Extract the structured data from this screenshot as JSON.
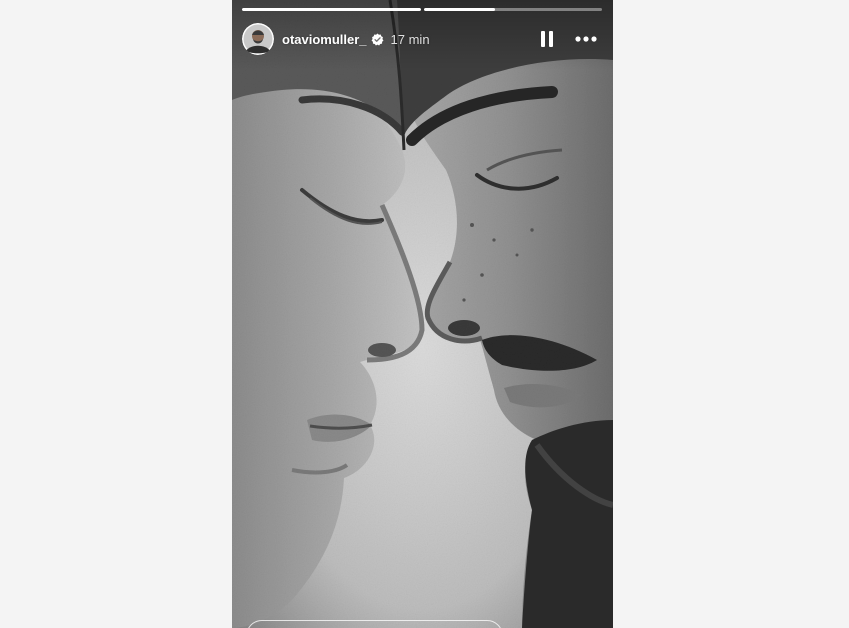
{
  "story": {
    "username": "otaviomuller_",
    "time_ago": "17 min",
    "progress": [
      1.0,
      0.4,
      0
    ],
    "icons": {
      "avatar": "avatar",
      "verified": "verified-badge-icon",
      "pause": "pause-icon",
      "more": "more-options-icon"
    }
  }
}
